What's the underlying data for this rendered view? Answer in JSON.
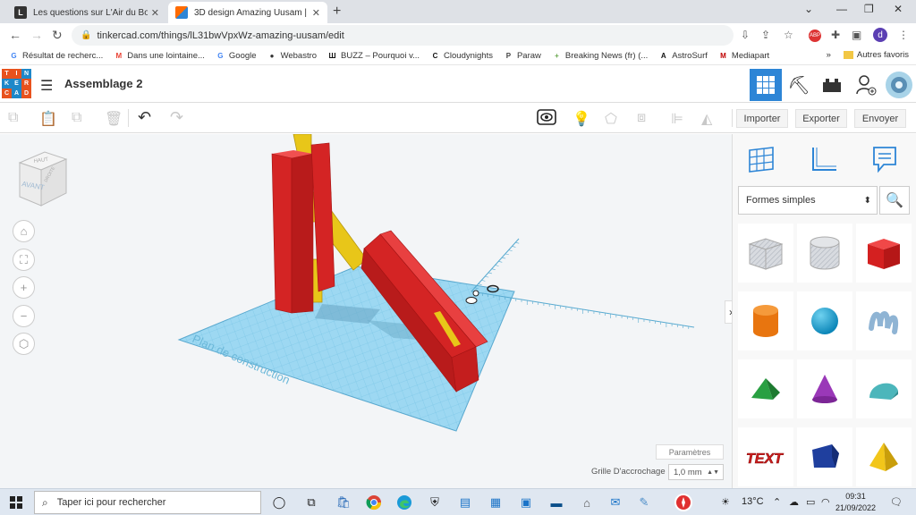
{
  "browser": {
    "tabs": [
      {
        "title": "Les questions sur L'Air du Bois",
        "favicon": "L",
        "favicon_color": "#333333",
        "active": false
      },
      {
        "title": "3D design Amazing Uusam | Tink",
        "favicon": "TC",
        "favicon_color": "#ff6b00",
        "active": true
      }
    ],
    "new_tab_icon": "plus-icon",
    "url": "tinkercad.com/things/lL31bwVpxWz-amazing-uusam/edit",
    "profile_initial": "d",
    "bookmarks": [
      {
        "label": "Résultat de recherc...",
        "icon": "G",
        "color": "#4285f4"
      },
      {
        "label": "Dans une lointaine...",
        "icon": "M",
        "color": "#ea4335"
      },
      {
        "label": "Google",
        "icon": "G",
        "color": "#4285f4"
      },
      {
        "label": "Webastro",
        "icon": "●",
        "color": "#333333"
      },
      {
        "label": "BUZZ – Pourquoi v...",
        "icon": "Ш",
        "color": "#111111"
      },
      {
        "label": "Cloudynights",
        "icon": "C",
        "color": "#111111"
      },
      {
        "label": "Paraw",
        "icon": "P",
        "color": "#444444"
      },
      {
        "label": "Breaking News (fr) (...",
        "icon": "+",
        "color": "#6aa84f"
      },
      {
        "label": "AstroSurf",
        "icon": "A",
        "color": "#111111"
      },
      {
        "label": "Mediapart",
        "icon": "M",
        "color": "#c00000"
      }
    ],
    "other_favorites": "Autres favoris"
  },
  "tinkercad": {
    "logo_letters": [
      "T",
      "I",
      "N",
      "K",
      "E",
      "R",
      "C",
      "A",
      "D"
    ],
    "project_title": "Assemblage 2",
    "toolbar": {
      "import_label": "Importer",
      "export_label": "Exporter",
      "send_label": "Envoyer"
    },
    "viewcube": {
      "top_label": "HAUT",
      "front_label": "AVANT",
      "right_label": "DROITE"
    },
    "workplane_label": "Plan de construction",
    "parameters_label": "Paramètres",
    "grid_label": "Grille D'accrochage",
    "grid_value": "1,0 mm",
    "shapes_category": "Formes simples",
    "text_shape": "TEXT",
    "colors": {
      "accent": "#2d85d6",
      "red": "#dd2222",
      "yellow": "#e8c619",
      "plane": "#87cfee"
    }
  },
  "taskbar": {
    "search_placeholder": "Taper ici pour rechercher",
    "temperature": "13°C",
    "time": "09:31",
    "date": "21/09/2022"
  }
}
